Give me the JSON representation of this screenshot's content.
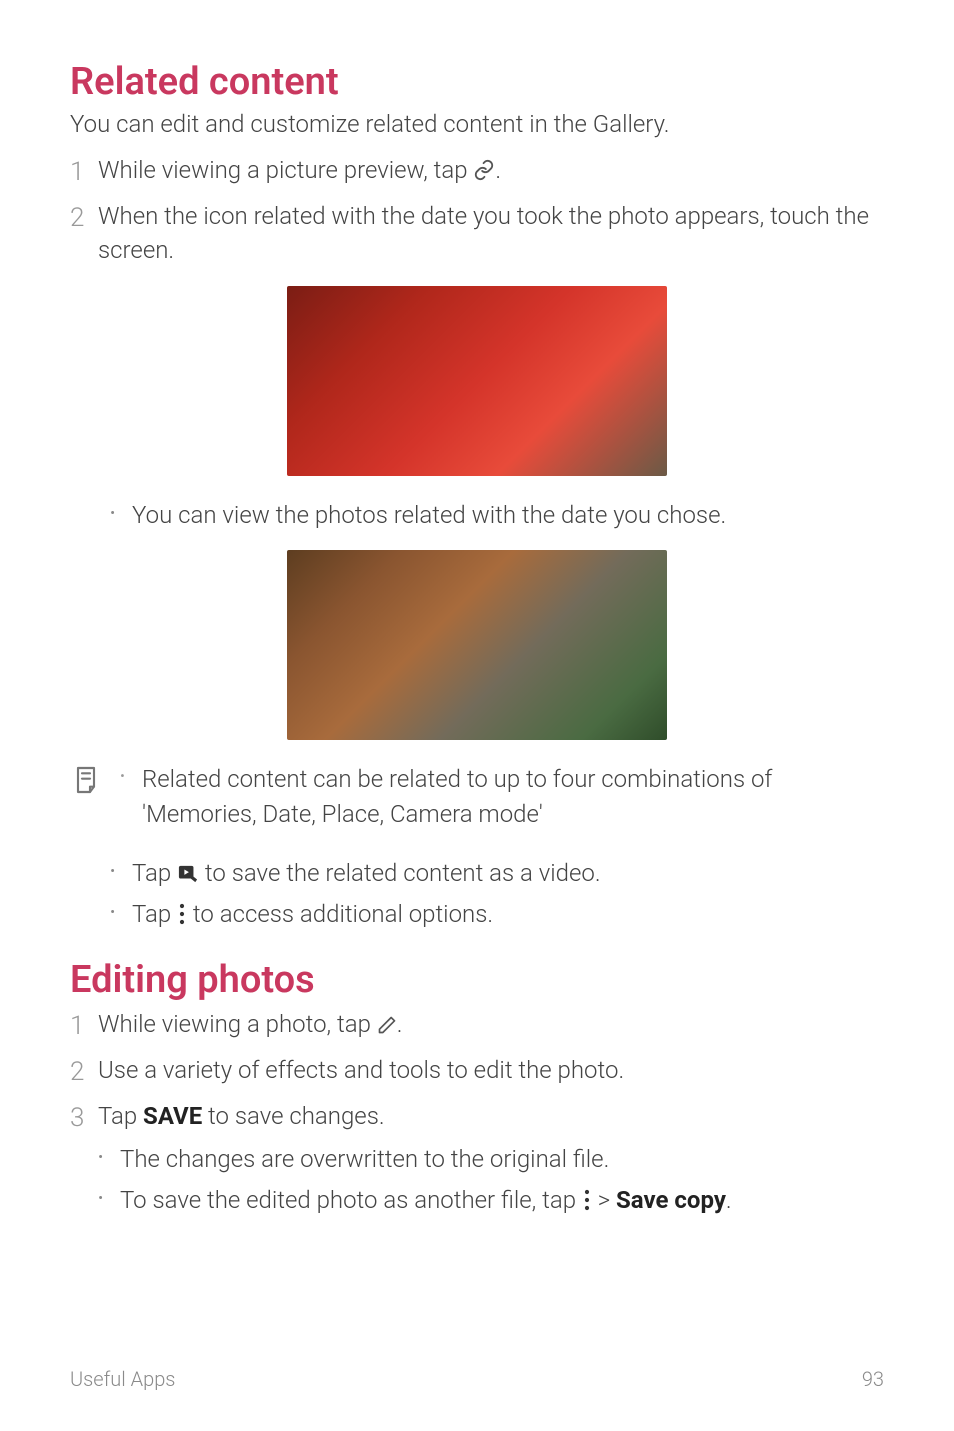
{
  "section1": {
    "title": "Related content",
    "intro": "You can edit and customize related content in the Gallery.",
    "step1": {
      "num": "1",
      "text_before": "While viewing a picture preview, tap ",
      "text_after": "."
    },
    "step2": {
      "num": "2",
      "text": "When the icon related with the date you took the photo appears, touch the screen."
    },
    "bullet1": "You can view the photos related with the date you chose.",
    "note": "Related content can be related to up to four combinations of 'Memories, Date, Place, Camera mode'",
    "bullet_save_video": {
      "before": "Tap ",
      "after": " to save the related content as a video."
    },
    "bullet_more": {
      "before": "Tap ",
      "after": " to access additional options."
    }
  },
  "section2": {
    "title": "Editing photos",
    "step1": {
      "num": "1",
      "text_before": "While viewing a photo, tap ",
      "text_after": "."
    },
    "step2": {
      "num": "2",
      "text": "Use a variety of effects and tools to edit the photo."
    },
    "step3": {
      "num": "3",
      "before": "Tap ",
      "save_label": "SAVE",
      "after": " to save changes."
    },
    "sub_bullet1": "The changes are overwritten to the original file.",
    "sub_bullet2": {
      "before": "To save the edited photo as another file, tap ",
      "gt": " > ",
      "save_copy": "Save copy",
      "after": "."
    }
  },
  "footer": {
    "left": "Useful Apps",
    "right": "93"
  }
}
